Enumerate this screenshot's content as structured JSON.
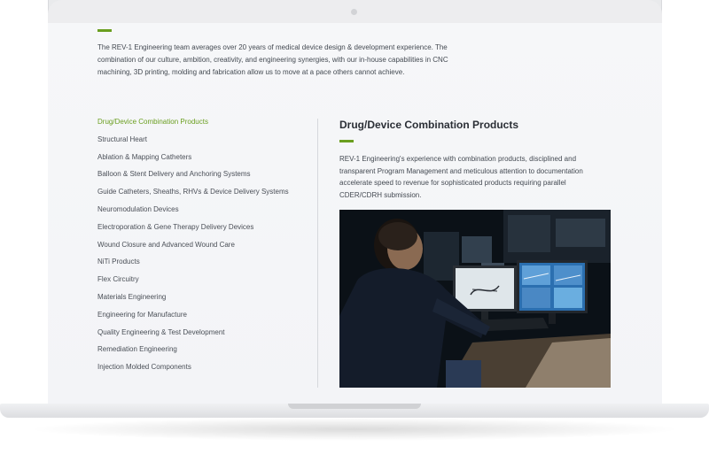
{
  "intro": {
    "text": "The REV-1 Engineering team averages over 20 years of medical device design & development experience. The combination of our culture, ambition, creativity, and engineering synergies, with our in-house capabilities in CNC machining, 3D printing, molding and fabrication allow us to move at a pace others cannot achieve."
  },
  "sidebar": {
    "items": [
      {
        "label": "Drug/Device Combination Products",
        "active": true
      },
      {
        "label": "Structural Heart"
      },
      {
        "label": "Ablation & Mapping Catheters"
      },
      {
        "label": "Balloon & Stent Delivery and Anchoring Systems"
      },
      {
        "label": "Guide Catheters, Sheaths, RHVs & Device Delivery Systems"
      },
      {
        "label": "Neuromodulation Devices"
      },
      {
        "label": "Electroporation & Gene Therapy Delivery Devices"
      },
      {
        "label": "Wound Closure and Advanced Wound Care"
      },
      {
        "label": "NiTi Products"
      },
      {
        "label": "Flex Circuitry"
      },
      {
        "label": "Materials Engineering"
      },
      {
        "label": "Engineering for Manufacture"
      },
      {
        "label": "Quality Engineering & Test Development"
      },
      {
        "label": "Remediation Engineering"
      },
      {
        "label": "Injection Molded Components"
      }
    ]
  },
  "content": {
    "title": "Drug/Device Combination Products",
    "body": "REV-1 Engineering's experience with combination products, disciplined and transparent Program Management and meticulous attention to documentation accelerate speed to revenue for sophisticated products requiring parallel CDER/CDRH submission."
  },
  "colors": {
    "accent": "#6a9e1f",
    "text": "#444a52",
    "heading": "#2b2f36"
  }
}
